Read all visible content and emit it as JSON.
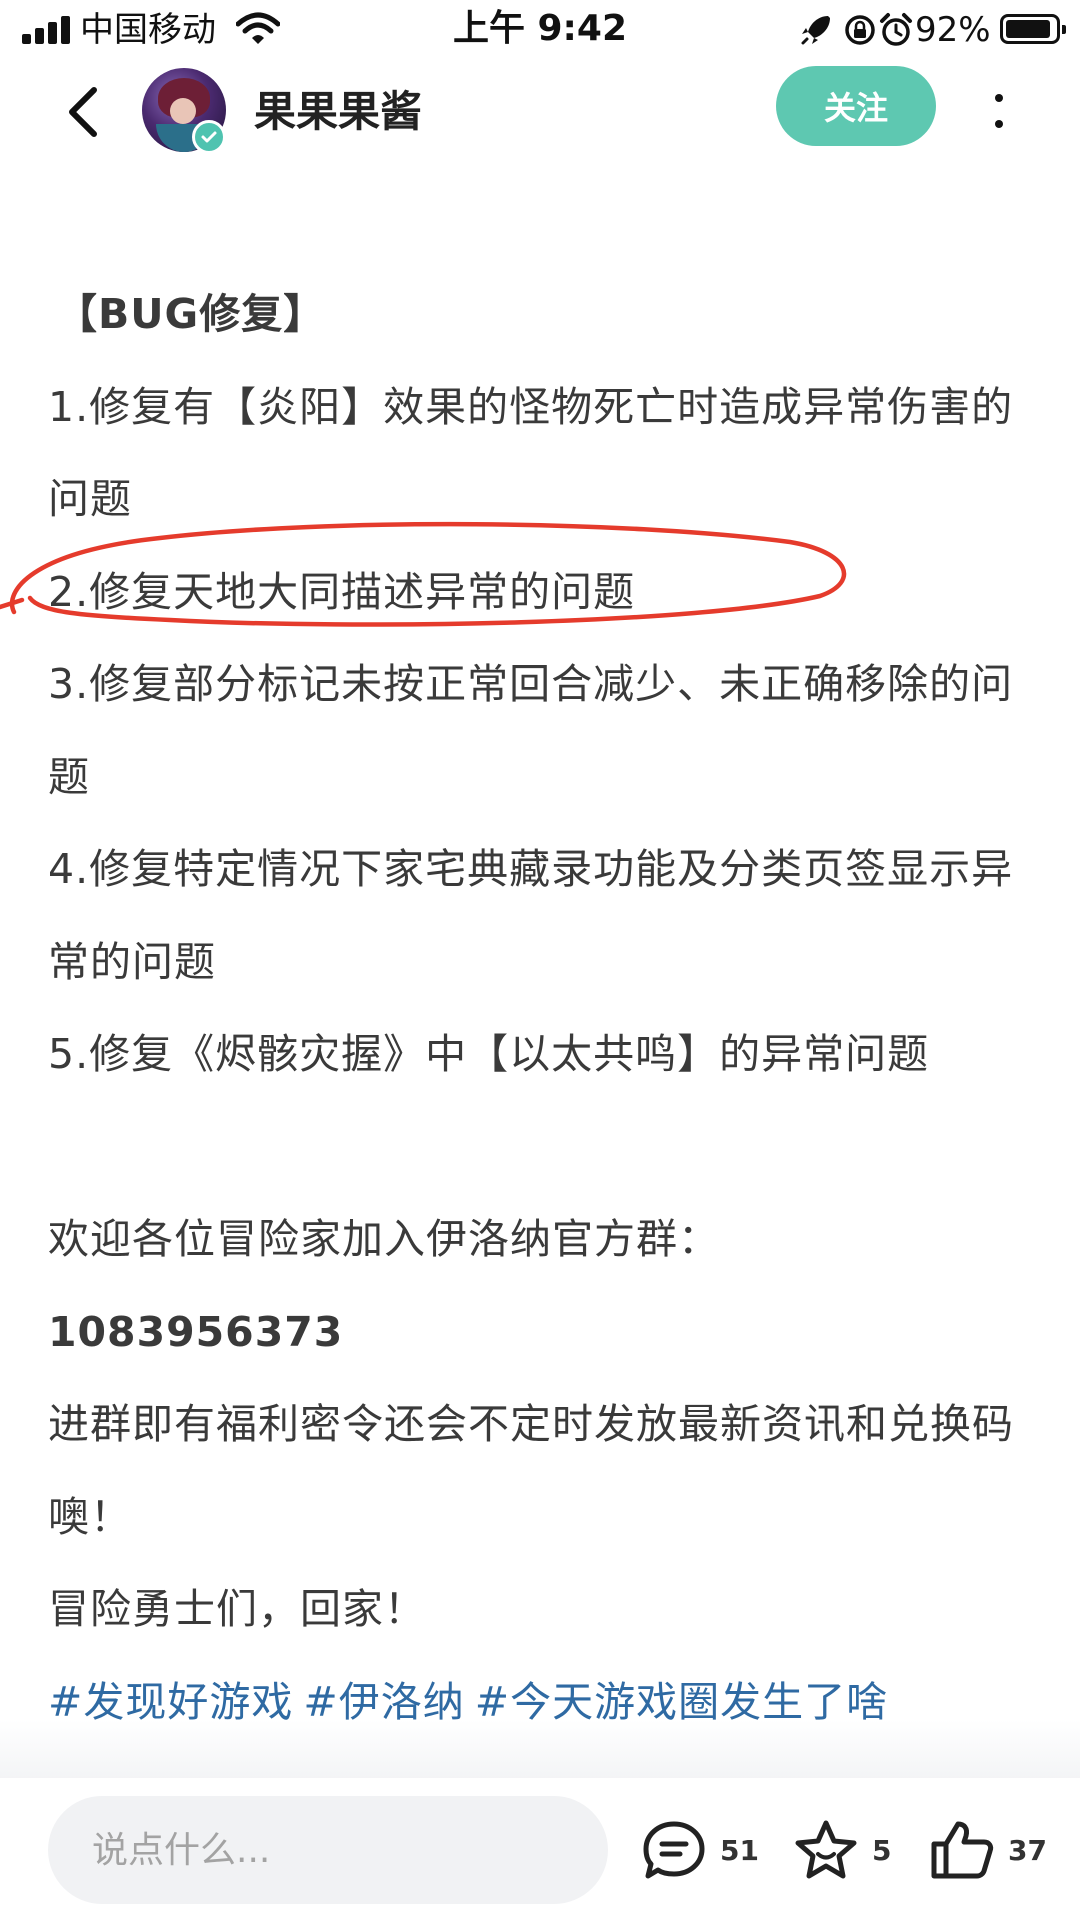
{
  "status_bar": {
    "carrier": "中国移动",
    "time": "上午 9:42",
    "battery": "92%"
  },
  "header": {
    "username": "果果果酱",
    "follow_label": "关注"
  },
  "post": {
    "heading": "【BUG修复】",
    "items": [
      "1.修复有【炎阳】效果的怪物死亡时造成异常伤害的问题",
      "2.修复天地大同描述异常的问题",
      "3.修复部分标记未按正常回合减少、未正确移除的问题",
      "4.修复特定情况下家宅典藏录功能及分类页签显示异常的问题",
      "5.修复《烬骸灾握》中【以太共鸣】的异常问题"
    ],
    "welcome": "欢迎各位冒险家加入伊洛纳官方群：",
    "group_number": "1083956373",
    "benefit": "进群即有福利密令还会不定时发放最新资讯和兑换码噢！",
    "closing": "冒险勇士们，回家！",
    "tags": [
      "#发现好游戏",
      "#伊洛纳",
      "#今天游戏圈发生了啥"
    ]
  },
  "annotation": {
    "color": "#e53b2c"
  },
  "bottom_bar": {
    "comment_placeholder": "说点什么...",
    "comment_count": "51",
    "favorite_count": "5",
    "like_count": "37"
  },
  "colors": {
    "accent": "#5ec8b1",
    "tag": "#2f6aa3"
  }
}
